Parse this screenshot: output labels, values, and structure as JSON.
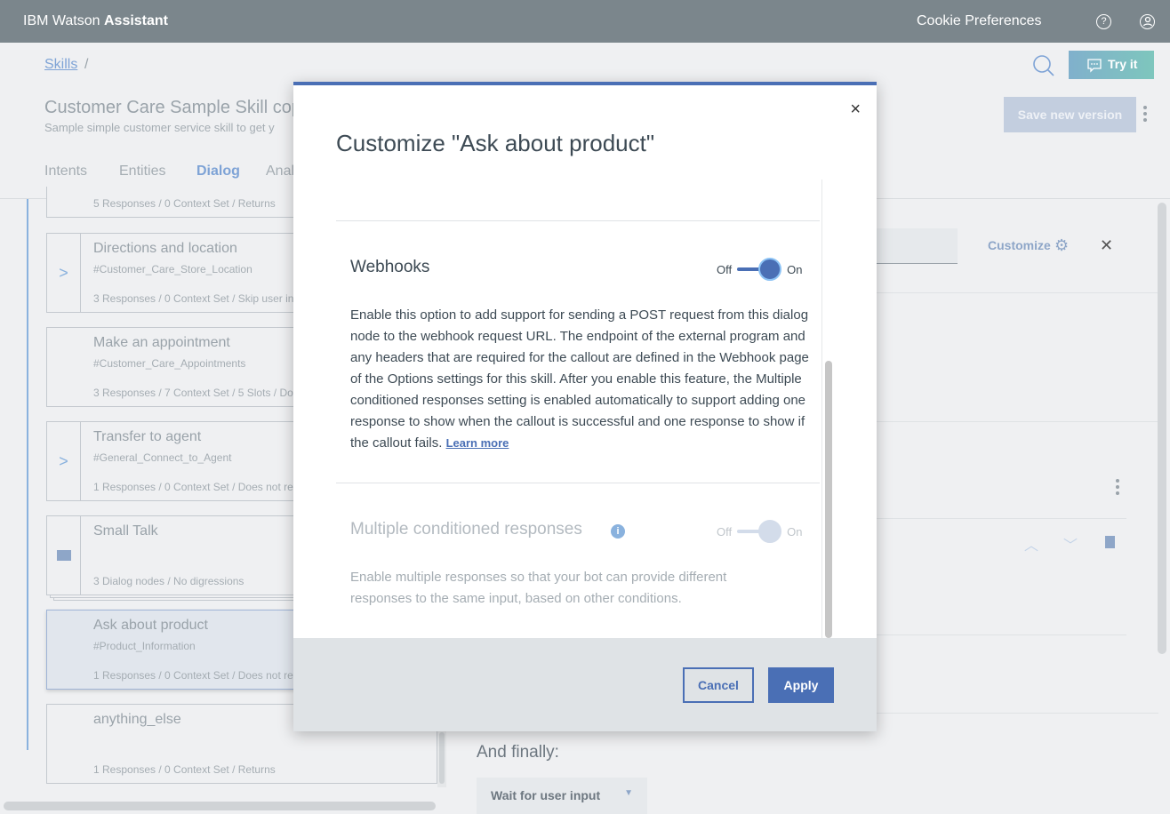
{
  "topbar": {
    "brand_light": "IBM Watson ",
    "brand_bold": "Assistant",
    "cookie": "Cookie Preferences",
    "help_icon": "?",
    "user_icon": "user"
  },
  "page": {
    "breadcrumb": "Skills",
    "breadcrumb_sep": "/",
    "title": "Customer Care Sample Skill cop",
    "subtitle": "Sample simple customer service skill to get y",
    "tabs": [
      {
        "label": "Intents"
      },
      {
        "label": "Entities"
      },
      {
        "label": "Dialog",
        "active": true
      },
      {
        "label": "Anal"
      }
    ],
    "try_it": "Try it",
    "save_version": "Save new version",
    "customize": "Customize",
    "and_finally": "And finally:",
    "wait_select": "Wait for user input"
  },
  "nodes": [
    {
      "name": "",
      "condition": "",
      "meta": "5 Responses / 0 Context Set / Returns"
    },
    {
      "name": "Directions and location",
      "condition": "#Customer_Care_Store_Location",
      "meta": "3 Responses / 0 Context Set / Skip user in",
      "expander": ">"
    },
    {
      "name": "Make an appointment",
      "condition": "#Customer_Care_Appointments",
      "meta": "3 Responses / 7 Context Set / 5 Slots / Do"
    },
    {
      "name": "Transfer to agent",
      "condition": "#General_Connect_to_Agent",
      "meta": "1 Responses / 0 Context Set / Does not ret",
      "expander": ">"
    },
    {
      "name": "Small Talk",
      "condition": "",
      "meta": "3 Dialog nodes / No digressions",
      "folder": true
    },
    {
      "name": "Ask about product",
      "condition": "#Product_Information",
      "meta": "1 Responses / 0 Context Set / Does not ret",
      "selected": true
    },
    {
      "name": "anything_else",
      "condition": "",
      "meta": "1 Responses / 0 Context Set / Returns"
    }
  ],
  "modal": {
    "title": "Customize \"Ask about product\"",
    "close": "×",
    "webhooks": {
      "title": "Webhooks",
      "off": "Off",
      "on": "On",
      "enabled": true,
      "desc": "Enable this option to add support for sending a POST request from this dialog node to the webhook request URL. The endpoint of the external program and any headers that are required for the callout are defined in the Webhook page of the Options settings for this skill. After you enable this feature, the Multiple conditioned responses setting is enabled automatically to support adding one response to show when the callout is successful and one response to show if the callout fails.",
      "learn_more": "Learn more"
    },
    "multiple": {
      "title": "Multiple conditioned responses",
      "off": "Off",
      "on": "On",
      "enabled": true,
      "disabled": true,
      "desc": "Enable multiple responses so that your bot can provide different responses to the same input, based on other conditions."
    },
    "cancel": "Cancel",
    "apply": "Apply"
  },
  "colors": {
    "accent": "#4a6fb5",
    "topbar": "#7b868c",
    "footer": "#dfe3e6"
  }
}
